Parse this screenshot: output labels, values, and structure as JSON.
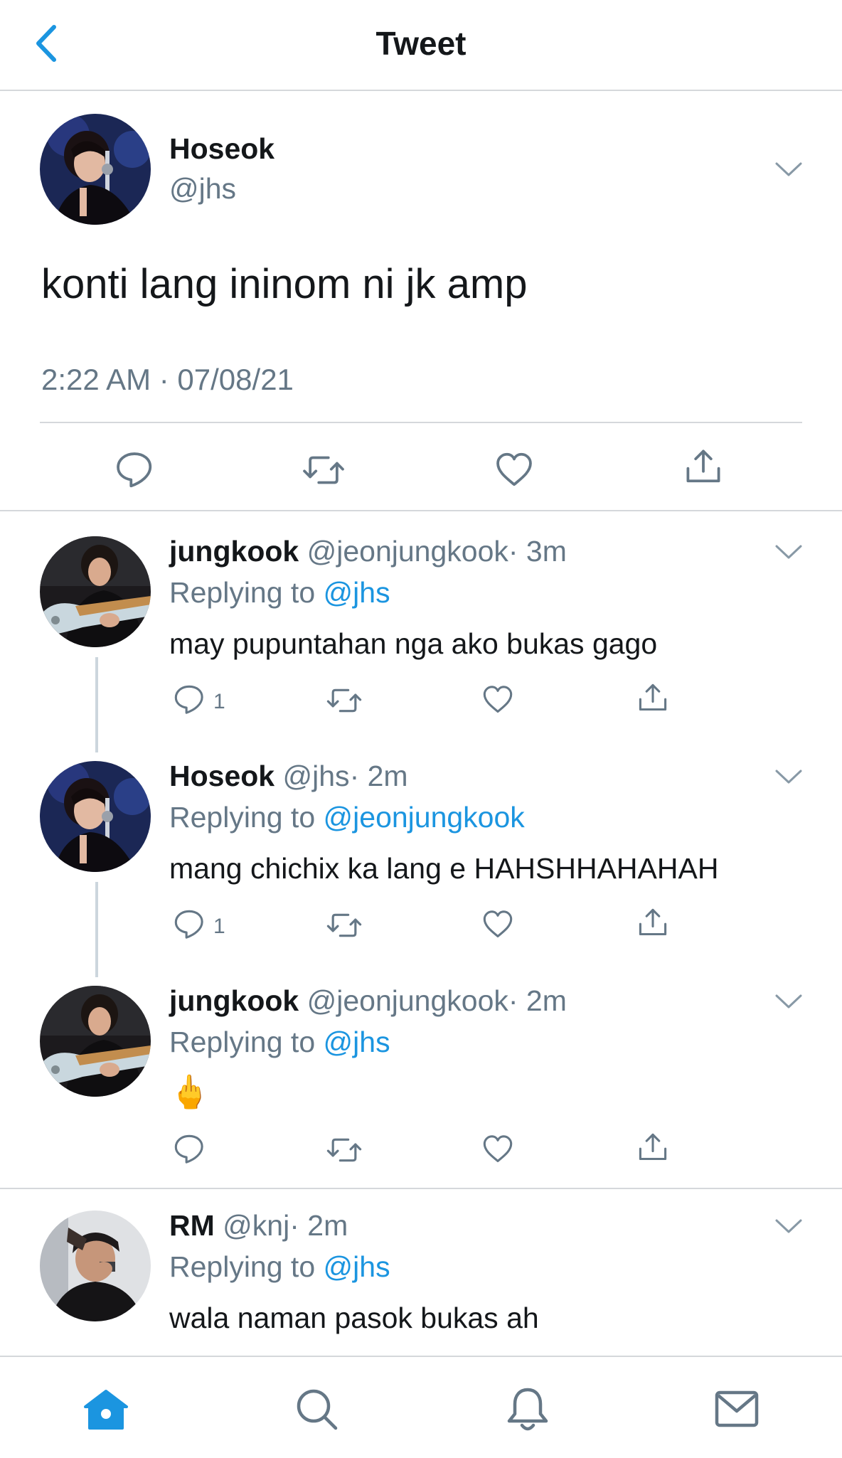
{
  "header": {
    "title": "Tweet"
  },
  "main_tweet": {
    "name": "Hoseok",
    "handle": "@jhs",
    "text": "konti lang ininom ni jk amp",
    "timestamp": "2:22 AM · 07/08/21",
    "avatar": "hoseok-avatar"
  },
  "replies": [
    {
      "name": "jungkook",
      "handle": "@jeonjungkook",
      "time": "· 3m",
      "replying_label": "Replying to",
      "replying_to": "@jhs",
      "text": "may pupuntahan nga ako bukas gago",
      "reply_count": "1"
    },
    {
      "name": "Hoseok",
      "handle": "@jhs",
      "time": "· 2m",
      "replying_label": "Replying to",
      "replying_to": "@jeonjungkook",
      "text": "mang chichix ka lang e HAHSHHAHAHAH",
      "reply_count": "1"
    },
    {
      "name": "jungkook",
      "handle": "@jeonjungkook",
      "time": "· 2m",
      "replying_label": "Replying to",
      "replying_to": "@jhs",
      "text": "🖕",
      "reply_count": ""
    },
    {
      "name": "RM",
      "handle": "@knj",
      "time": "· 2m",
      "replying_label": "Replying to",
      "replying_to": "@jhs",
      "text": "wala naman pasok bukas ah",
      "reply_count": ""
    }
  ],
  "icons": {
    "back": "chevron-left-icon",
    "reply": "reply-icon",
    "retweet": "retweet-icon",
    "like": "heart-icon",
    "share": "share-icon",
    "more": "chevron-down-icon",
    "home": "home-icon",
    "search": "search-icon",
    "notifications": "bell-icon",
    "messages": "mail-icon"
  },
  "colors": {
    "accent": "#1b95e0",
    "secondary_text": "#657786",
    "border": "#d5d8db",
    "thread_line": "#ccd6dd"
  }
}
